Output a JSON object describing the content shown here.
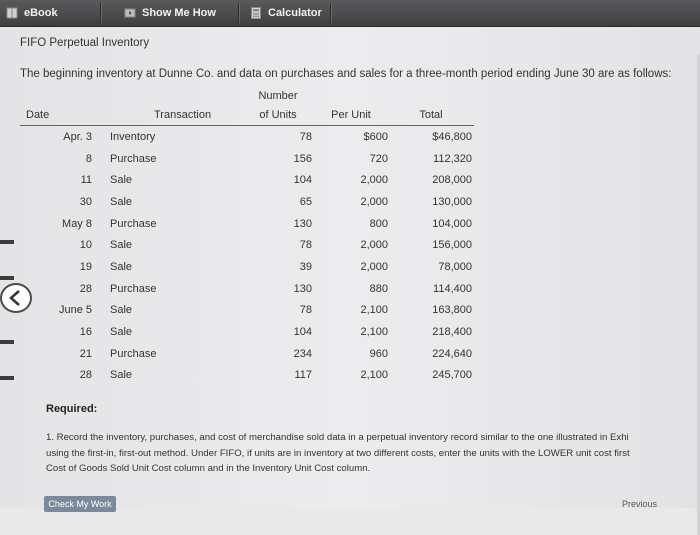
{
  "toolbar": {
    "ebook_label": "eBook",
    "show_me_how_label": "Show Me How",
    "calculator_label": "Calculator"
  },
  "page_title": "FIFO Perpetual Inventory",
  "intro": "The beginning inventory at Dunne Co. and data on purchases and sales for a three-month period ending June 30 are as follows:",
  "table": {
    "headers": {
      "date": "Date",
      "transaction": "Transaction",
      "units_line1": "Number",
      "units_line2": "of Units",
      "per_unit": "Per Unit",
      "total": "Total"
    },
    "rows": [
      {
        "date": "Apr. 3",
        "transaction": "Inventory",
        "units": "78",
        "per_unit": "$600",
        "total": "$46,800"
      },
      {
        "date": "8",
        "transaction": "Purchase",
        "units": "156",
        "per_unit": "720",
        "total": "112,320"
      },
      {
        "date": "11",
        "transaction": "Sale",
        "units": "104",
        "per_unit": "2,000",
        "total": "208,000"
      },
      {
        "date": "30",
        "transaction": "Sale",
        "units": "65",
        "per_unit": "2,000",
        "total": "130,000"
      },
      {
        "date": "May 8",
        "transaction": "Purchase",
        "units": "130",
        "per_unit": "800",
        "total": "104,000"
      },
      {
        "date": "10",
        "transaction": "Sale",
        "units": "78",
        "per_unit": "2,000",
        "total": "156,000"
      },
      {
        "date": "19",
        "transaction": "Sale",
        "units": "39",
        "per_unit": "2,000",
        "total": "78,000"
      },
      {
        "date": "28",
        "transaction": "Purchase",
        "units": "130",
        "per_unit": "880",
        "total": "114,400"
      },
      {
        "date": "June 5",
        "transaction": "Sale",
        "units": "78",
        "per_unit": "2,100",
        "total": "163,800"
      },
      {
        "date": "16",
        "transaction": "Sale",
        "units": "104",
        "per_unit": "2,100",
        "total": "218,400"
      },
      {
        "date": "21",
        "transaction": "Purchase",
        "units": "234",
        "per_unit": "960",
        "total": "224,640"
      },
      {
        "date": "28",
        "transaction": "Sale",
        "units": "117",
        "per_unit": "2,100",
        "total": "245,700"
      }
    ]
  },
  "required_label": "Required:",
  "instruction_lines": [
    "1. Record the inventory, purchases, and cost of merchandise sold data in a perpetual inventory record similar to the one illustrated in Exhi",
    "using the first-in, first-out method. Under FIFO, if units are in inventory at two different costs, enter the units with the LOWER unit cost first",
    "Cost of Goods Sold Unit Cost column and in the Inventory Unit Cost column."
  ],
  "check_work_label": "Check My Work",
  "previous_label": "Previous",
  "colors": {
    "toolbar_bg": "#4a4a4d",
    "content_bg": "#e9e9ea",
    "button_bg": "#7b8a9a"
  },
  "icons": [
    "ebook-icon",
    "show-me-how-icon",
    "calculator-icon",
    "back-arrow-icon"
  ]
}
